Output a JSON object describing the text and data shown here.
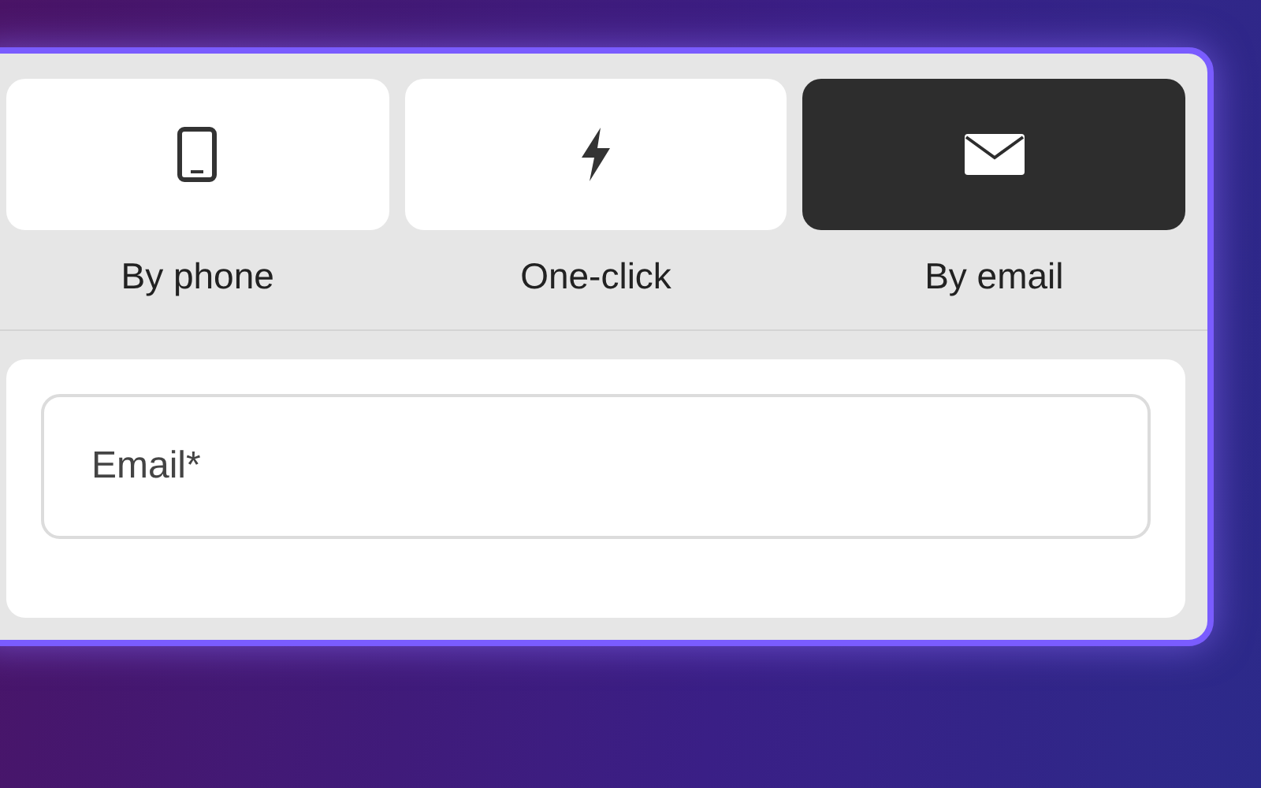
{
  "tabs": [
    {
      "label": "By phone",
      "selected": false
    },
    {
      "label": "One-click",
      "selected": false
    },
    {
      "label": "By email",
      "selected": true
    }
  ],
  "email_field": {
    "placeholder": "Email*"
  }
}
